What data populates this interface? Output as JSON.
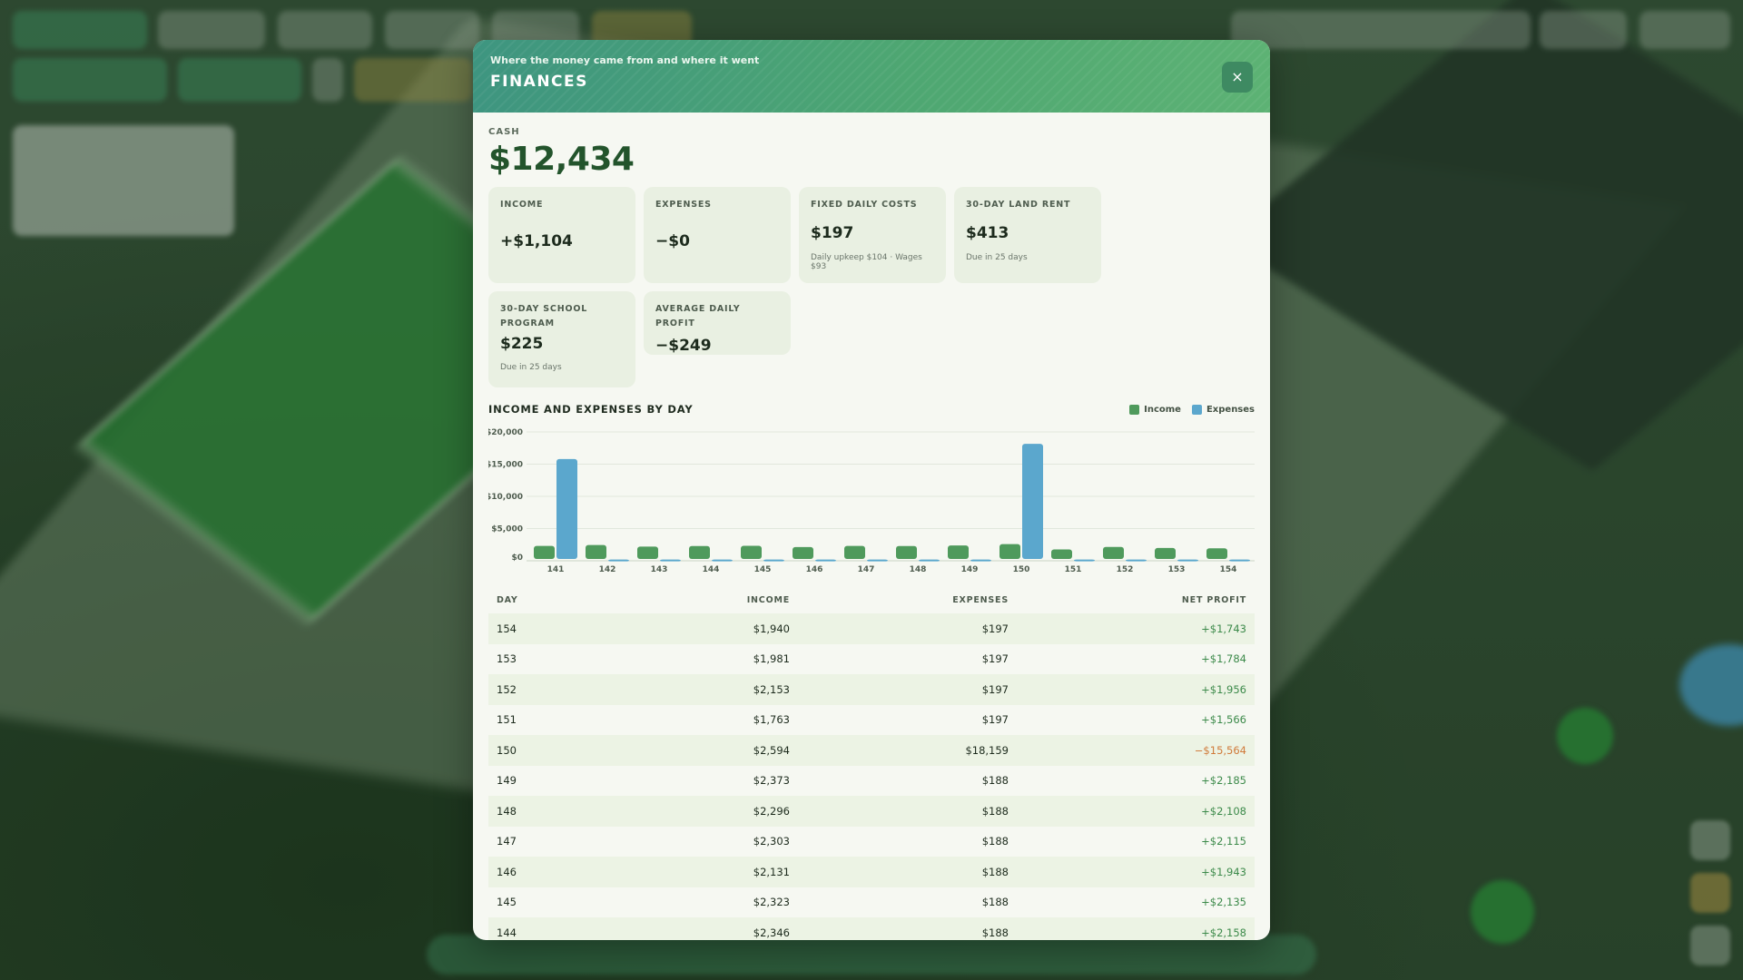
{
  "modal": {
    "subtitle": "Where the money came from and where it went",
    "title": "FINANCES",
    "close_icon": "×"
  },
  "cash": {
    "label": "CASH",
    "value": "$12,434"
  },
  "cards": [
    {
      "label": "INCOME",
      "value": "+$1,104",
      "note": ""
    },
    {
      "label": "EXPENSES",
      "value": "−$0",
      "note": ""
    },
    {
      "label": "FIXED DAILY COSTS",
      "value": "$197",
      "note": "Daily upkeep $104 · Wages $93"
    },
    {
      "label": "30-DAY LAND RENT",
      "value": "$413",
      "note": "Due in 25 days"
    },
    {
      "label": "30-DAY SCHOOL PROGRAM",
      "value": "$225",
      "note": "Due in 25 days"
    },
    {
      "label": "AVERAGE DAILY PROFIT",
      "value": "−$249",
      "note": ""
    }
  ],
  "chart_section": {
    "title": "INCOME AND EXPENSES BY DAY",
    "legend_income": "Income",
    "legend_expenses": "Expenses"
  },
  "colors": {
    "income": "#4f9a5c",
    "expenses": "#5ba7cd",
    "accent": "#4ea772"
  },
  "chart_data": {
    "type": "bar",
    "categories": [
      "141",
      "142",
      "143",
      "144",
      "145",
      "146",
      "147",
      "148",
      "149",
      "150",
      "151",
      "152",
      "153",
      "154"
    ],
    "series": [
      {
        "name": "Income",
        "values": [
          2300,
          2450,
          2200,
          2290,
          2323,
          2131,
          2303,
          2296,
          2373,
          2594,
          1763,
          2153,
          1981,
          1940
        ]
      },
      {
        "name": "Expenses",
        "values": [
          15800,
          188,
          188,
          188,
          188,
          188,
          188,
          188,
          188,
          18159,
          197,
          197,
          197,
          197
        ]
      }
    ],
    "yticks": [
      "$0",
      "$5,000",
      "$10,000",
      "$15,000",
      "$20,000"
    ],
    "ytick_values": [
      0,
      5000,
      10000,
      15000,
      20000
    ],
    "ylim": [
      0,
      20000
    ],
    "grid": true,
    "legend": "top-right"
  },
  "table": {
    "headers": [
      "DAY",
      "INCOME",
      "EXPENSES",
      "NET PROFIT"
    ],
    "rows": [
      {
        "day": "154",
        "income": "$1,940",
        "expenses": "$197",
        "net": "+$1,743"
      },
      {
        "day": "153",
        "income": "$1,981",
        "expenses": "$197",
        "net": "+$1,784"
      },
      {
        "day": "152",
        "income": "$2,153",
        "expenses": "$197",
        "net": "+$1,956"
      },
      {
        "day": "151",
        "income": "$1,763",
        "expenses": "$197",
        "net": "+$1,566"
      },
      {
        "day": "150",
        "income": "$2,594",
        "expenses": "$18,159",
        "net": "−$15,564"
      },
      {
        "day": "149",
        "income": "$2,373",
        "expenses": "$188",
        "net": "+$2,185"
      },
      {
        "day": "148",
        "income": "$2,296",
        "expenses": "$188",
        "net": "+$2,108"
      },
      {
        "day": "147",
        "income": "$2,303",
        "expenses": "$188",
        "net": "+$2,115"
      },
      {
        "day": "146",
        "income": "$2,131",
        "expenses": "$188",
        "net": "+$1,943"
      },
      {
        "day": "145",
        "income": "$2,323",
        "expenses": "$188",
        "net": "+$2,135"
      },
      {
        "day": "144",
        "income": "$2,346",
        "expenses": "$188",
        "net": "+$2,158"
      }
    ]
  }
}
